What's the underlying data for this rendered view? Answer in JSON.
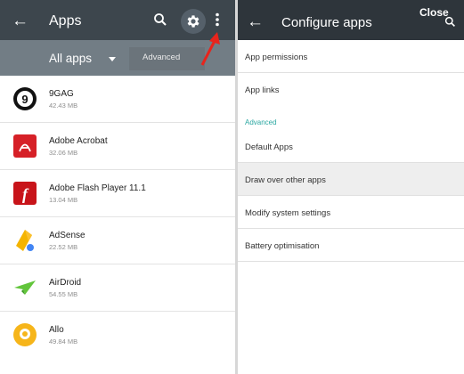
{
  "left": {
    "title": "Apps",
    "filter_label": "All apps",
    "tooltip": "Advanced",
    "apps": [
      {
        "name": "9GAG",
        "size": "42.43 MB"
      },
      {
        "name": "Adobe Acrobat",
        "size": "32.06 MB"
      },
      {
        "name": "Adobe Flash Player 11.1",
        "size": "13.04 MB"
      },
      {
        "name": "AdSense",
        "size": "22.52 MB"
      },
      {
        "name": "AirDroid",
        "size": "54.55 MB"
      },
      {
        "name": "Allo",
        "size": "49.84 MB"
      }
    ]
  },
  "right": {
    "title": "Configure apps",
    "close_label": "Close",
    "items_top": [
      "App permissions",
      "App links"
    ],
    "section": "Advanced",
    "items_advanced": [
      "Default Apps",
      "Draw over other apps",
      "Modify system settings",
      "Battery optimisation"
    ]
  },
  "colors": {
    "appbar_left": "#3d464d",
    "appbar_right": "#2e353b",
    "subbar": "#727d85",
    "accent_teal": "#2aa7a1",
    "annotation_red": "#e8241c"
  }
}
